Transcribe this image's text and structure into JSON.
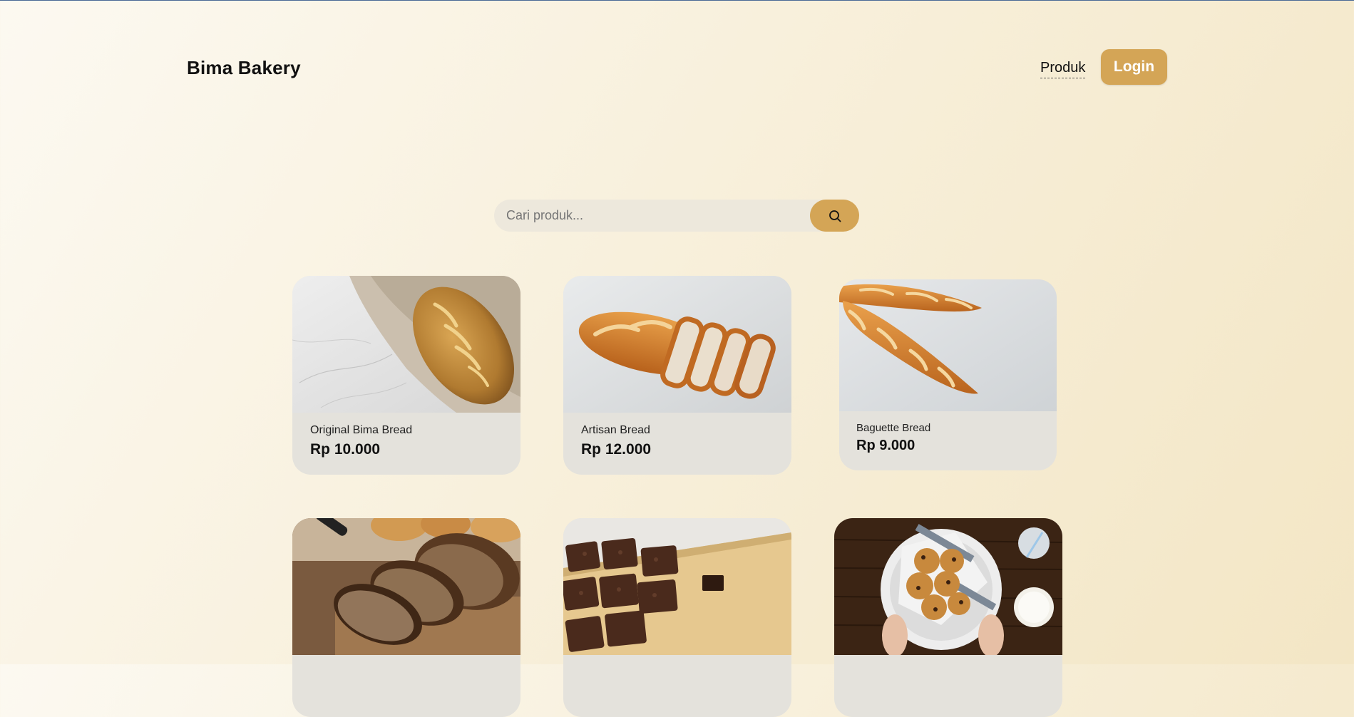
{
  "header": {
    "brand": "Bima Bakery",
    "nav_link": "Produk",
    "login_label": "Login"
  },
  "search": {
    "placeholder": "Cari produk...",
    "icon": "search-icon"
  },
  "products": [
    {
      "name": "Original Bima Bread",
      "price": "Rp 10.000",
      "image": "rustic-loaf-on-marble"
    },
    {
      "name": "Artisan Bread",
      "price": "Rp 12.000",
      "image": "sliced-artisan-loaf"
    },
    {
      "name": "Baguette Bread",
      "price": "Rp 9.000",
      "image": "baguettes-on-concrete"
    },
    {
      "image": "sliced-rye-bread"
    },
    {
      "image": "brownie-squares-on-board"
    },
    {
      "image": "cookies-in-basket"
    }
  ],
  "colors": {
    "accent": "#d4a556",
    "card_bg": "#e4e2dc",
    "search_bg": "#ede8dc"
  }
}
